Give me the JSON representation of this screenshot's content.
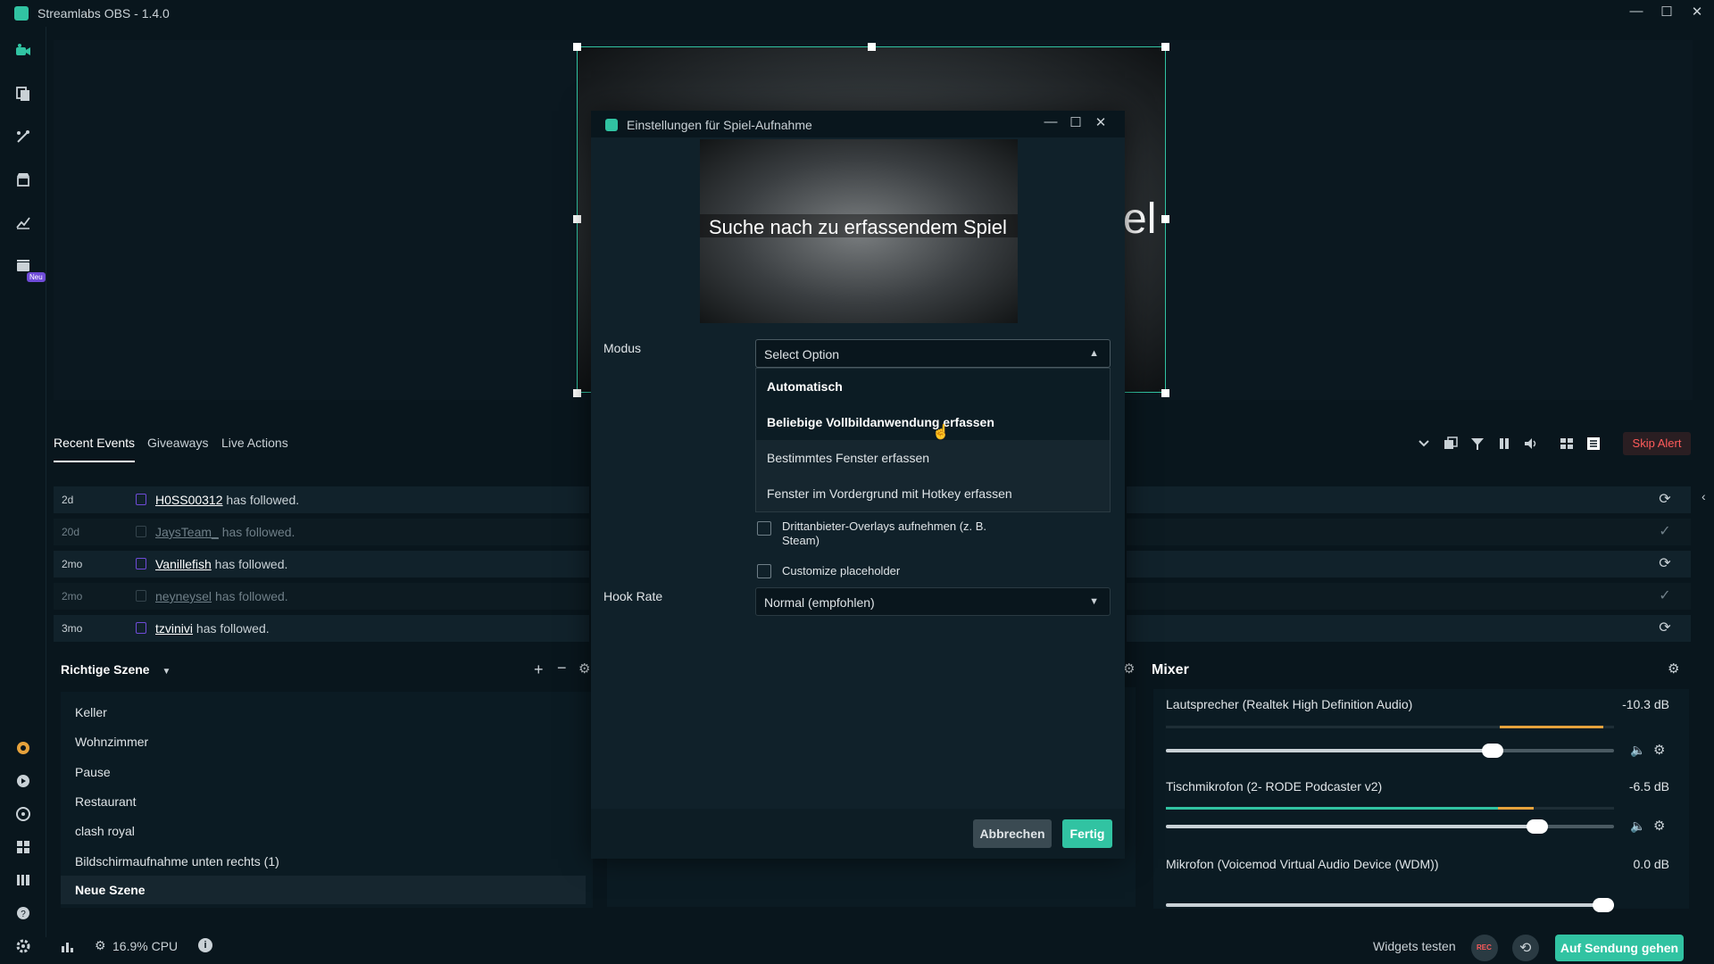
{
  "window": {
    "title": "Streamlabs OBS - 1.4.0",
    "controls": [
      "—",
      "☐",
      "✕"
    ]
  },
  "sidebar": {
    "badge_neu": "Neu"
  },
  "preview": {
    "overlay_text": "el"
  },
  "events": {
    "tabs": [
      {
        "label": "Recent Events",
        "active": true
      },
      {
        "label": "Giveaways",
        "active": false
      },
      {
        "label": "Live Actions",
        "active": false
      }
    ],
    "skip_alert": "Skip Alert",
    "rows": [
      {
        "ago": "2d",
        "user": "H0SS00312",
        "action": "has followed.",
        "dim": false
      },
      {
        "ago": "20d",
        "user": "JaysTeam_",
        "action": "has followed.",
        "dim": true
      },
      {
        "ago": "2mo",
        "user": "Vanillefish",
        "action": "has followed.",
        "dim": false
      },
      {
        "ago": "2mo",
        "user": "neyneysel",
        "action": "has followed.",
        "dim": true
      },
      {
        "ago": "3mo",
        "user": "tzvinivi",
        "action": "has followed.",
        "dim": false
      }
    ]
  },
  "scenes": {
    "collection": "Richtige Szene",
    "items": [
      "Keller",
      "Wohnzimmer",
      "Pause",
      "Restaurant",
      "clash royal",
      "Bildschirmaufnahme unten rechts (1)",
      "Neue Szene"
    ],
    "active_index": 6
  },
  "mixer": {
    "title": "Mixer",
    "sources": [
      {
        "name": "Lautsprecher (Realtek High Definition Audio)",
        "db": "-10.3 dB",
        "level": 0.72
      },
      {
        "name": "Tischmikrofon (2- RODE Podcaster v2)",
        "db": "-6.5 dB",
        "level": 0.82
      },
      {
        "name": "Mikrofon (Voicemod Virtual Audio Device (WDM))",
        "db": "0.0 dB",
        "level": 1.0
      }
    ]
  },
  "status": {
    "cpu": "16.9% CPU",
    "widgets_test": "Widgets testen",
    "rec": "REC",
    "go_live": "Auf Sendung gehen"
  },
  "dialog": {
    "title": "Einstellungen für Spiel-Aufnahme",
    "preview_caption": "Suche nach zu erfassendem Spiel",
    "mode_label": "Modus",
    "mode_placeholder": "Select Option",
    "mode_options": [
      "Automatisch",
      "Beliebige Vollbildanwendung erfassen",
      "Bestimmtes Fenster erfassen",
      "Fenster im Vordergrund mit Hotkey erfassen"
    ],
    "checkbox_overlays": "Drittanbieter-Overlays aufnehmen (z. B. Steam)",
    "checkbox_placeholder": "Customize placeholder",
    "hook_rate_label": "Hook Rate",
    "hook_rate_value": "Normal (empfohlen)",
    "cancel": "Abbrechen",
    "done": "Fertig"
  },
  "colors": {
    "accent": "#31c3a2",
    "background": "#09161d",
    "panel": "#0b1b23",
    "danger": "#ff5b5b"
  }
}
